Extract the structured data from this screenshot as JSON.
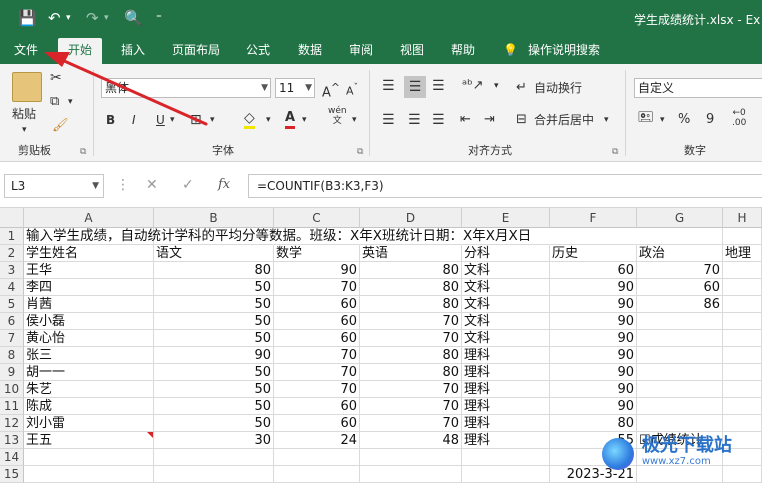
{
  "window": {
    "title": "学生成绩统计.xlsx - Ex"
  },
  "qa": {
    "save": "💾",
    "undo": "↶",
    "redo": "↷",
    "preview": "🔍",
    "more": "⁼"
  },
  "tabs": [
    "文件",
    "开始",
    "插入",
    "页面布局",
    "公式",
    "数据",
    "审阅",
    "视图",
    "帮助",
    "操作说明搜索"
  ],
  "ribbon": {
    "clipboard": {
      "paste": "粘贴",
      "label": "剪贴板"
    },
    "font": {
      "name": "黑体",
      "size": "11",
      "bold": "B",
      "italic": "I",
      "underline": "U",
      "color_a": "A",
      "wen": "wén",
      "label": "字体"
    },
    "align": {
      "wrap": "自动换行",
      "merge": "合并后居中",
      "label": "对齐方式"
    },
    "number": {
      "format": "自定义",
      "percent": "%",
      "comma": "9",
      "label": "数字"
    }
  },
  "formula_bar": {
    "name_box": "L3",
    "cancel": "✕",
    "enter": "✓",
    "fx": "fx",
    "formula": "=COUNTIF(B3:K3,F3)"
  },
  "columns": [
    "A",
    "B",
    "C",
    "D",
    "E",
    "F",
    "G",
    "H"
  ],
  "rows": [
    "1",
    "2",
    "3",
    "4",
    "5",
    "6",
    "7",
    "8",
    "9",
    "10",
    "11",
    "12",
    "13",
    "14",
    "15"
  ],
  "row1": "输入学生成绩，自动统计学科的平均分等数据。班级：X年X班统计日期：X年X月X日",
  "headers": [
    "学生姓名",
    "语文",
    "数学",
    "英语",
    "分科",
    "历史",
    "政治",
    "地理"
  ],
  "students": [
    {
      "name": "王华",
      "chinese": "80",
      "math": "90",
      "english": "80",
      "track": "文科",
      "history": "60",
      "politics": "70"
    },
    {
      "name": "李四",
      "chinese": "50",
      "math": "70",
      "english": "80",
      "track": "文科",
      "history": "90",
      "politics": "60"
    },
    {
      "name": "肖茜",
      "chinese": "50",
      "math": "60",
      "english": "80",
      "track": "文科",
      "history": "90",
      "politics": "86"
    },
    {
      "name": "侯小磊",
      "chinese": "50",
      "math": "60",
      "english": "70",
      "track": "文科",
      "history": "90",
      "politics": ""
    },
    {
      "name": "黄心怡",
      "chinese": "50",
      "math": "60",
      "english": "70",
      "track": "文科",
      "history": "90",
      "politics": ""
    },
    {
      "name": "张三",
      "chinese": "90",
      "math": "70",
      "english": "80",
      "track": "理科",
      "history": "90",
      "politics": ""
    },
    {
      "name": "胡一一",
      "chinese": "50",
      "math": "70",
      "english": "80",
      "track": "理科",
      "history": "90",
      "politics": ""
    },
    {
      "name": "朱艺",
      "chinese": "50",
      "math": "70",
      "english": "70",
      "track": "理科",
      "history": "90",
      "politics": ""
    },
    {
      "name": "陈成",
      "chinese": "50",
      "math": "60",
      "english": "70",
      "track": "理科",
      "history": "90",
      "politics": ""
    },
    {
      "name": "刘小雷",
      "chinese": "50",
      "math": "60",
      "english": "70",
      "track": "理科",
      "history": "80",
      "politics": ""
    },
    {
      "name": "王五",
      "chinese": "30",
      "math": "24",
      "english": "48",
      "track": "理科",
      "history": "55",
      "politics": "☑成绩统计"
    }
  ],
  "footer_date": "2023-3-21",
  "watermark": "极光下载站",
  "watermark_url": "www.xz7.com",
  "colors": {
    "excel_green": "#217346",
    "arrow_red": "#d9242a"
  }
}
